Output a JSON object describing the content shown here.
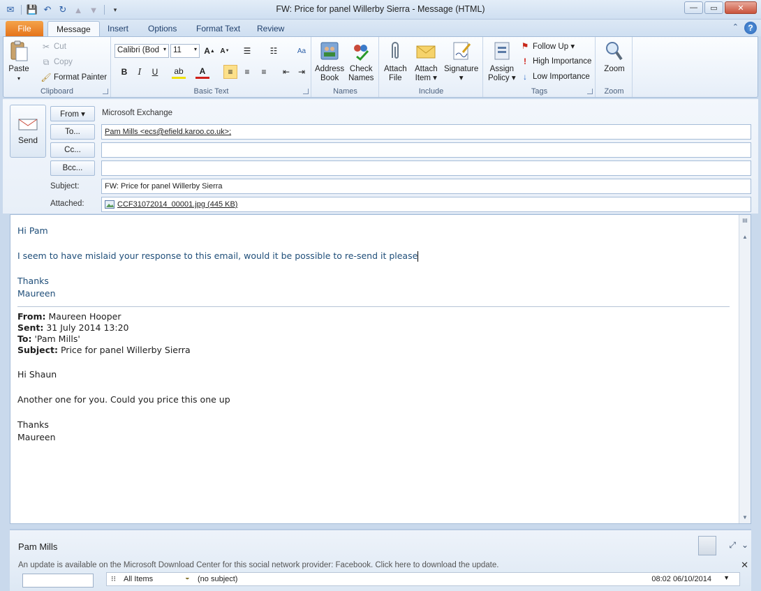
{
  "window": {
    "title": "FW: Price for panel Willerby Sierra  -  Message (HTML)",
    "controls": {
      "minimize": "—",
      "maximize": "▭",
      "close": "✕"
    }
  },
  "tabs": [
    "File",
    "Message",
    "Insert",
    "Options",
    "Format Text",
    "Review"
  ],
  "ribbon": {
    "clipboard": {
      "label": "Clipboard",
      "paste": "Paste",
      "cut": "Cut",
      "copy": "Copy",
      "format_painter": "Format Painter"
    },
    "basic_text": {
      "label": "Basic Text",
      "font": "Calibri (Bod",
      "size": "11"
    },
    "names": {
      "label": "Names",
      "address_book": [
        "Address",
        "Book"
      ],
      "check_names": [
        "Check",
        "Names"
      ]
    },
    "include": {
      "label": "Include",
      "attach_file": [
        "Attach",
        "File"
      ],
      "attach_item": [
        "Attach",
        "Item ▾"
      ],
      "signature": [
        "Signature",
        "▾"
      ]
    },
    "tags": {
      "label": "Tags",
      "assign_policy": [
        "Assign",
        "Policy ▾"
      ],
      "follow_up": "Follow Up ▾",
      "high": "High Importance",
      "low": "Low Importance"
    },
    "zoom": {
      "label": "Zoom",
      "zoom": "Zoom"
    }
  },
  "header": {
    "send": "Send",
    "from_button": "From ▾",
    "from_value": "Microsoft Exchange",
    "to_button": "To...",
    "to_value": "Pam Mills <ecs@efield.karoo.co.uk>;",
    "cc_button": "Cc...",
    "cc_value": "",
    "bcc_button": "Bcc...",
    "bcc_value": "",
    "subject_label": "Subject:",
    "subject_value": "FW: Price for panel Willerby Sierra",
    "attached_label": "Attached:",
    "attachment": "CCF31072014_00001.jpg (445 KB)"
  },
  "body": {
    "greeting": "Hi Pam",
    "line1": "I seem to have mislaid your response to this email, would it be possible to re-send it please",
    "thanks": "Thanks",
    "sign": "Maureen",
    "fwd": {
      "from_label": "From:",
      "from": "Maureen Hooper",
      "sent_label": "Sent:",
      "sent": "31 July 2014 13:20",
      "to_label": "To:",
      "to": "'Pam Mills'",
      "subject_label": "Subject:",
      "subject": "Price for panel Willerby Sierra",
      "greeting": "Hi Shaun",
      "line1": "Another one for you. Could you price this one up",
      "thanks": "Thanks",
      "sign": "Maureen"
    }
  },
  "people_pane": {
    "name": "Pam Mills",
    "update": "An update is available on the Microsoft Download Center for this social network provider: Facebook. Click here to download the update.",
    "feed_filter": "All Items",
    "feed_item": "(no subject)",
    "feed_time": "08:02  06/10/2014"
  }
}
